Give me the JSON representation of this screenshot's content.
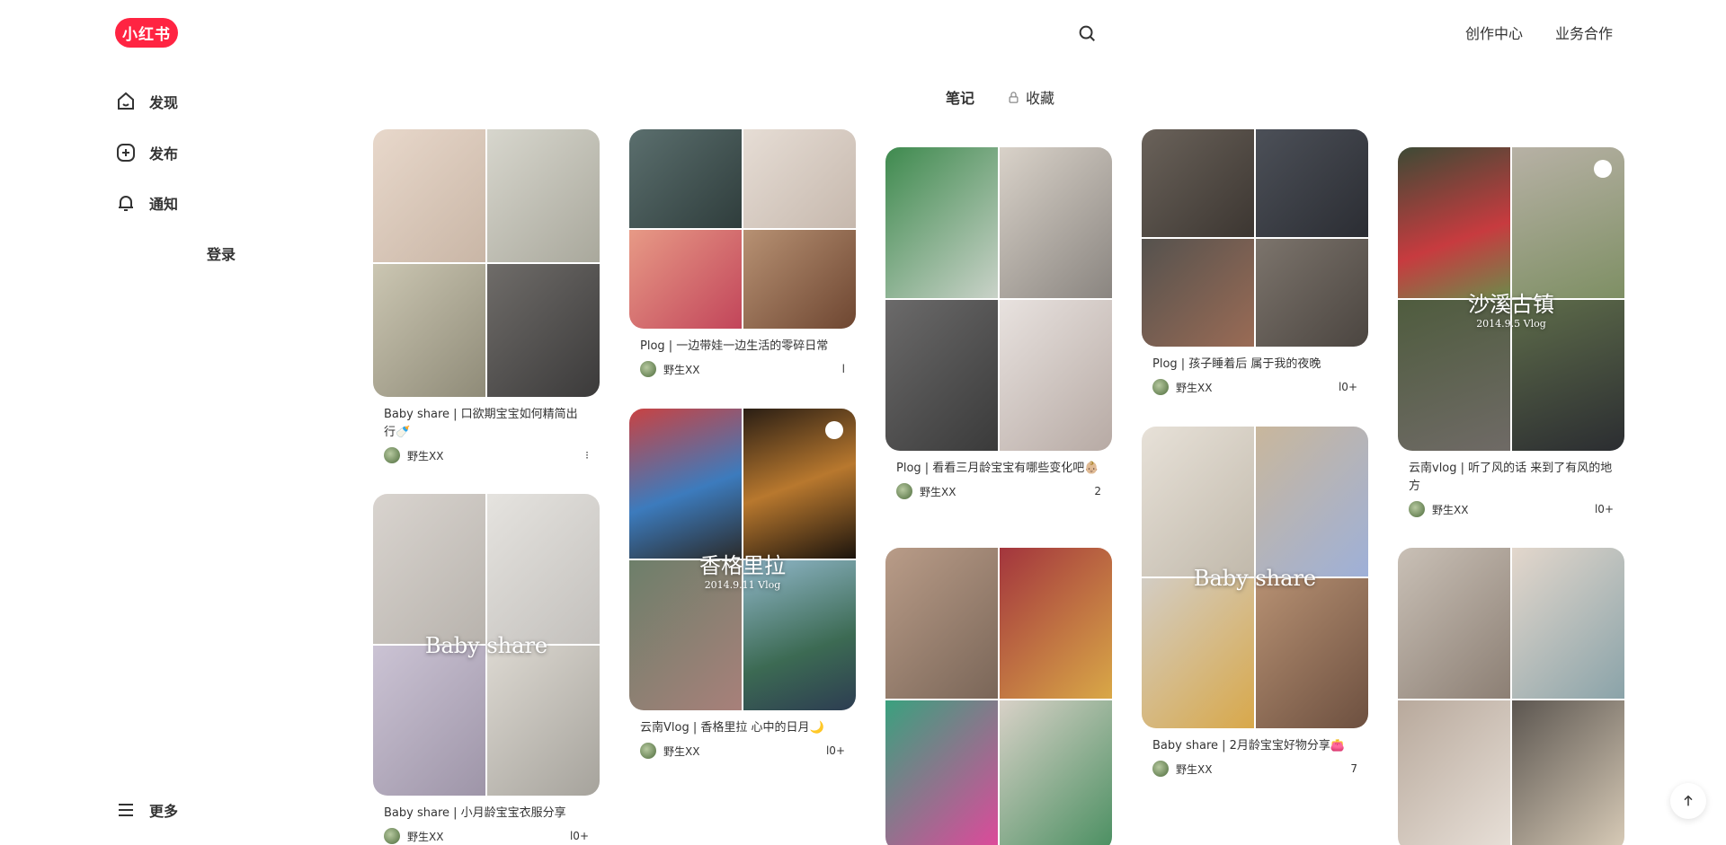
{
  "header": {
    "logo_text": "小红书",
    "search_icon": "search-icon",
    "links": [
      "创作中心",
      "业务合作"
    ]
  },
  "sidebar": {
    "items": [
      {
        "label": "发现",
        "icon": "home-icon"
      },
      {
        "label": "发布",
        "icon": "plus-square-icon"
      },
      {
        "label": "通知",
        "icon": "bell-icon"
      }
    ],
    "login_label": "登录",
    "more_label": "更多"
  },
  "tabs": {
    "notes_label": "笔记",
    "collect_label": "收藏"
  },
  "notes": [
    {
      "title": "Baby share | 口欲期宝宝如何精简出行🍼",
      "author": "野生XX",
      "likes": "⁝",
      "overlay": "",
      "overlay_sub": ""
    },
    {
      "title": "Baby share | 小月龄宝宝衣服分享",
      "author": "野生XX",
      "likes": "l0+",
      "overlay": "Baby share",
      "overlay_sub": ""
    },
    {
      "title": "Plog | 一边带娃一边生活的零碎日常",
      "author": "野生XX",
      "likes": "l",
      "overlay": "",
      "overlay_sub": ""
    },
    {
      "title": "云南Vlog | 香格里拉 心中的日月🌙",
      "author": "野生XX",
      "likes": "l0+",
      "overlay": "香格里拉",
      "overlay_sub": "2014.9.11 Vlog"
    },
    {
      "title": "Plog | 看看三月龄宝宝有哪些变化吧👶🏼",
      "author": "野生XX",
      "likes": "2",
      "overlay": "",
      "overlay_sub": ""
    },
    {
      "title": "",
      "author": "",
      "likes": "",
      "overlay": "",
      "overlay_sub": ""
    },
    {
      "title": "Plog | 孩子睡着后 属于我的夜晚",
      "author": "野生XX",
      "likes": "l0+",
      "overlay": "",
      "overlay_sub": ""
    },
    {
      "title": "Baby share | 2月龄宝宝好物分享👛",
      "author": "野生XX",
      "likes": "7",
      "overlay": "Baby share",
      "overlay_sub": ""
    },
    {
      "title": "云南vlog | 听了风的话 来到了有风的地方",
      "author": "野生XX",
      "likes": "l0+",
      "overlay": "沙溪古镇",
      "overlay_sub": "2014.9.5 Vlog"
    },
    {
      "title": "",
      "author": "",
      "likes": "",
      "overlay": "",
      "overlay_sub": ""
    }
  ],
  "colors": {
    "brand": "#ff2442",
    "text": "#333333"
  },
  "scroll_top_icon": "arrow-up-icon"
}
